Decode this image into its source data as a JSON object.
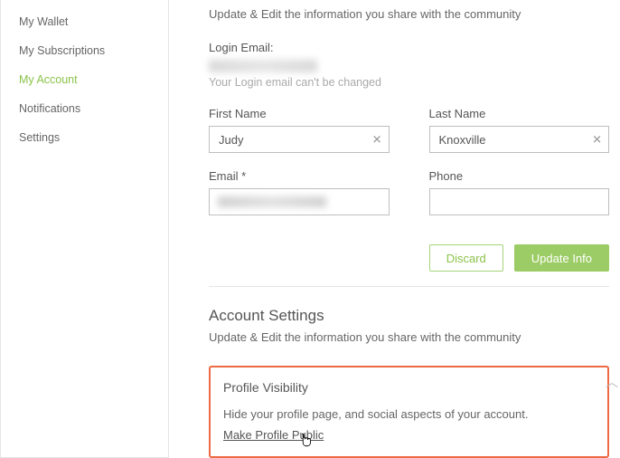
{
  "sidebar": {
    "items": [
      {
        "label": "My Wallet"
      },
      {
        "label": "My Subscriptions"
      },
      {
        "label": "My Account"
      },
      {
        "label": "Notifications"
      },
      {
        "label": "Settings"
      }
    ]
  },
  "main": {
    "update_desc": "Update & Edit the information you share with the community",
    "login_email_label": "Login Email:",
    "login_email_hint": "Your Login email can't be changed",
    "first_name_label": "First Name",
    "last_name_label": "Last Name",
    "first_name_value": "Judy",
    "last_name_value": "Knoxville",
    "email_label": "Email *",
    "phone_label": "Phone",
    "email_value": "",
    "phone_value": "",
    "discard_label": "Discard",
    "update_label": "Update Info"
  },
  "settings": {
    "title": "Account Settings",
    "desc": "Update & Edit the information you share with the community"
  },
  "visibility": {
    "title": "Profile Visibility",
    "desc": "Hide your profile page, and social aspects of your account.",
    "link": "Make Profile Public"
  }
}
